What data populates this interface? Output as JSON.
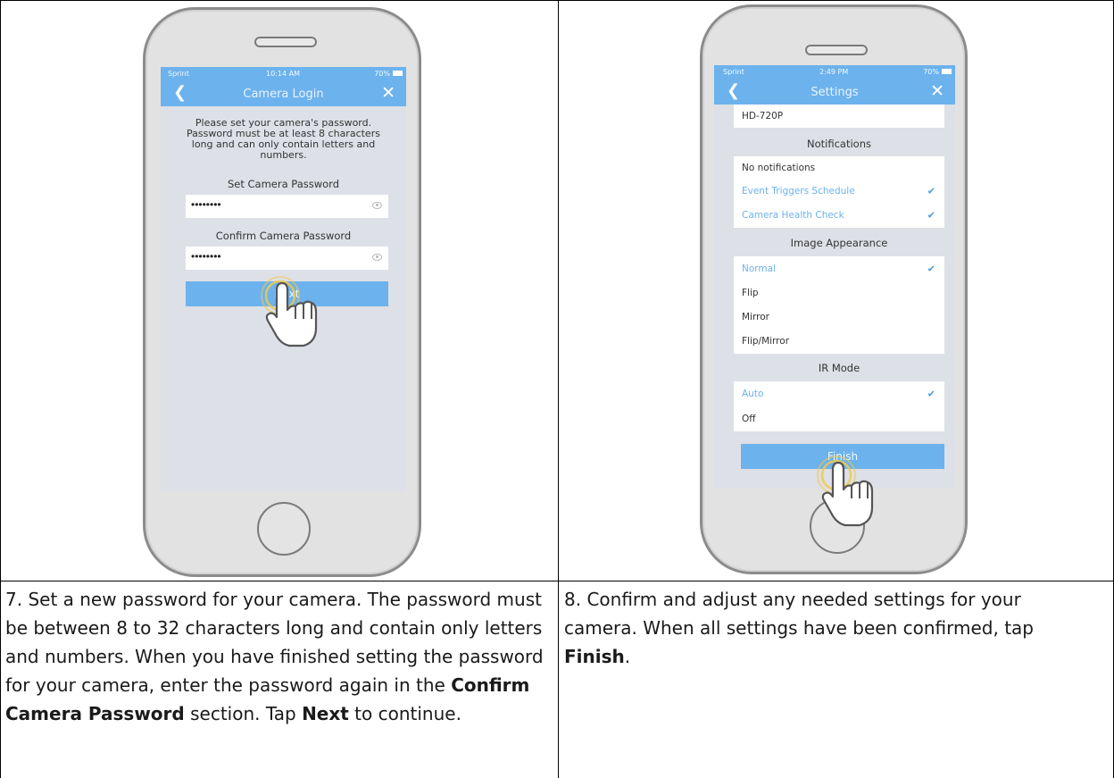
{
  "left_phone": {
    "status": {
      "carrier": "Sprint",
      "time": "10:14 AM",
      "battery": "70%"
    },
    "nav": {
      "back_icon": "chevron-left-icon",
      "title": "Camera Login",
      "close_icon": "close-icon"
    },
    "intro": "Please set your camera's password. Password must be at least 8 characters long and can only contain letters and numbers.",
    "set_label": "Set Camera Password",
    "set_value": "••••••••",
    "confirm_label": "Confirm Camera Password",
    "confirm_value": "••••••••",
    "next_label": "Next"
  },
  "right_phone": {
    "status": {
      "carrier": "Sprint",
      "time": "2:49 PM",
      "battery": "70%"
    },
    "nav": {
      "back_icon": "chevron-left-icon",
      "title": "Settings",
      "close_icon": "close-icon"
    },
    "resolution": "HD-720P",
    "notifications": {
      "header": "Notifications",
      "items": [
        "No notifications",
        "Event Triggers Schedule",
        "Camera Health Check"
      ]
    },
    "image_appearance": {
      "header": "Image Appearance",
      "items": [
        "Normal",
        "Flip",
        "Mirror",
        "Flip/Mirror"
      ]
    },
    "ir_mode": {
      "header": "IR Mode",
      "items": [
        "Auto",
        "Off"
      ]
    },
    "finish_label": "Finish"
  },
  "captions": {
    "step7": {
      "t1": "7. Set a new password for your camera. The password must be between 8 to 32 characters long and contain only letters and numbers. When you have finished setting the password for your camera, enter the password again in the ",
      "b1": "Confirm Camera Password",
      "t2": " section. Tap ",
      "b2": "Next",
      "t3": " to continue."
    },
    "step8": {
      "t1": "8. Confirm and adjust any needed settings for your camera. When all settings have been confirmed, tap ",
      "b1": "Finish",
      "t2": "."
    }
  },
  "colors": {
    "accent": "#6cb2ed",
    "check": "#4a9be0",
    "phone_body": "#e2e2e2"
  }
}
